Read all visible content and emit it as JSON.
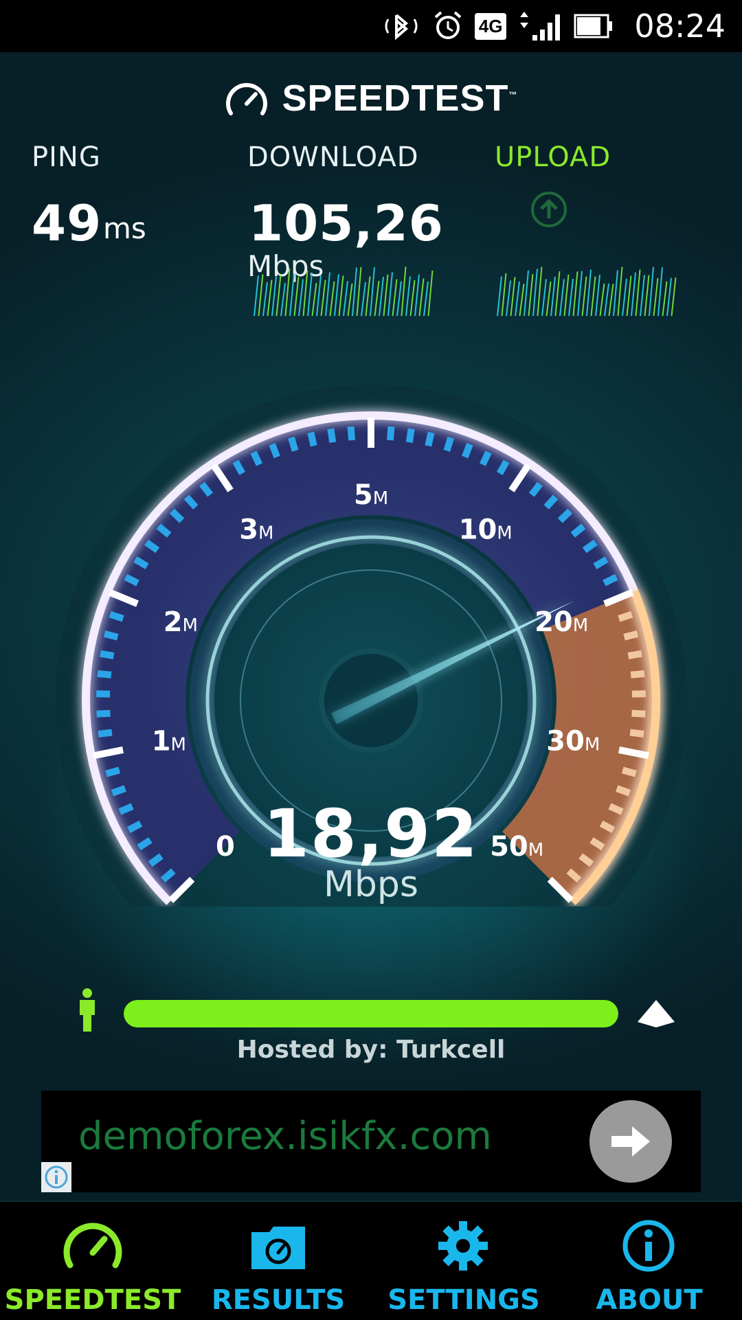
{
  "status_bar": {
    "network_badge": "4G",
    "time": "08:24",
    "icons": [
      "bluetooth-icon",
      "alarm-icon",
      "network-4g-icon",
      "signal-icon",
      "battery-icon"
    ]
  },
  "header": {
    "logo_text": "SPEEDTEST",
    "trademark": "™"
  },
  "metrics": {
    "ping": {
      "label": "PING",
      "value": "49",
      "unit": "ms"
    },
    "download": {
      "label": "DOWNLOAD",
      "value": "105,26",
      "unit": "Mbps"
    },
    "upload": {
      "label": "UPLOAD",
      "state_icon": "upload-arrow-icon"
    }
  },
  "gauge": {
    "scale_labels": [
      "0",
      "1",
      "2",
      "3",
      "5",
      "10",
      "20",
      "30",
      "50"
    ],
    "scale_unit": "M",
    "current_value": "18,92",
    "current_unit": "Mbps"
  },
  "progress": {
    "fraction": 1.0,
    "hosted_by": "Hosted by: Turkcell"
  },
  "ad": {
    "url_text": "demoforex.isikfx.com"
  },
  "nav": {
    "items": [
      {
        "label": "SPEEDTEST",
        "icon": "speedometer-icon",
        "active": true
      },
      {
        "label": "RESULTS",
        "icon": "results-folder-icon",
        "active": false
      },
      {
        "label": "SETTINGS",
        "icon": "gear-icon",
        "active": false
      },
      {
        "label": "ABOUT",
        "icon": "info-icon",
        "active": false
      }
    ]
  },
  "colors": {
    "accent_green": "#8bea2a",
    "accent_cyan": "#1ab7ec",
    "gauge_orange": "#e6893a",
    "gauge_blue": "#2ba4e8"
  }
}
